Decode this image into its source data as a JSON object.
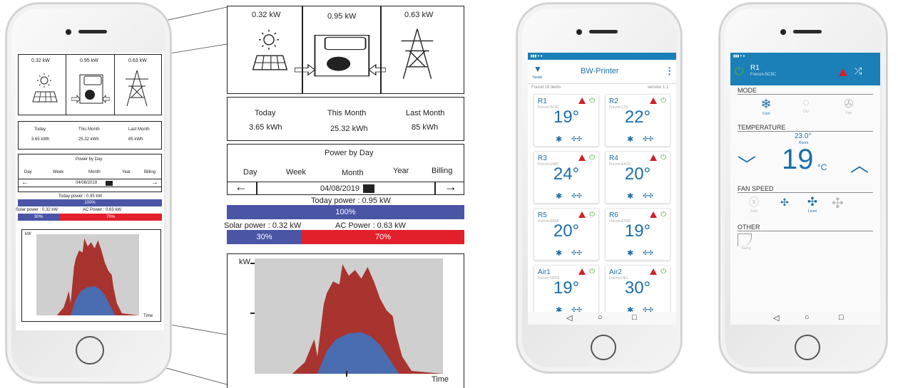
{
  "monitor": {
    "power_values": [
      "0.32 kW",
      "0.95 kW",
      "0.63 kW"
    ],
    "energy": {
      "headers": [
        "Today",
        "This Month",
        "Last Month"
      ],
      "values": [
        "3.65 kWh",
        "25.32 kWh",
        "85 kWh"
      ]
    },
    "power_by_day": {
      "title": "Power by Day",
      "tabs": [
        "Day",
        "Week",
        "Month",
        "Year",
        "Billing"
      ],
      "date": "04/08/2019",
      "prev_arrow": "←",
      "next_arrow": "→"
    },
    "today_power": {
      "label": "Today power : 0.95 kW",
      "percent_label": "100%",
      "percent": 100
    },
    "solar_power": {
      "label": "Solar power :  0.32 kW",
      "percent_label": "30%",
      "percent": 30
    },
    "ac_power": {
      "label": "AC Power : 0.63 kW",
      "percent_label": "70%",
      "percent": 70
    },
    "chart": {
      "y_label": "kW",
      "x_label": "Time"
    }
  },
  "ac_app": {
    "title": "BW-Printer",
    "menu_icon": "⋮",
    "wifi_label": "Tasaki",
    "found_text": "Found 16 items",
    "version_text": "version 1.1",
    "units": [
      {
        "name": "R1",
        "sub": "Frecon-5C9C",
        "temp": "19°"
      },
      {
        "name": "R2",
        "sub": "Frecon-C25",
        "temp": "22°"
      },
      {
        "name": "R3",
        "sub": "Frecon-E489",
        "temp": "24°"
      },
      {
        "name": "R4",
        "sub": "Frecon-E4CE",
        "temp": "20°"
      },
      {
        "name": "R5",
        "sub": "Frecon-E68A",
        "temp": "20°"
      },
      {
        "name": "R6",
        "sub": "Frecon-E7DC",
        "temp": "19°"
      },
      {
        "name": "Air1",
        "sub": "Frecon-DDFE",
        "temp": "19°"
      },
      {
        "name": "Air2",
        "sub": "Frecon-DE1",
        "temp": "30°"
      }
    ],
    "nav": [
      "◁",
      "○",
      "□"
    ]
  },
  "detail_app": {
    "unit_name": "R1",
    "unit_sub": "Frecon-5C9C",
    "mode_title": "MODE",
    "modes": [
      "Cool",
      "Dry",
      "Fan"
    ],
    "temperature_title": "TEMPERATURE",
    "room_temp": "23.0°",
    "room_label": "Room",
    "set_temp": "19",
    "unit": "°C",
    "down_arrow": "﹀",
    "up_arrow": "︿",
    "fan_title": "FAN SPEED",
    "fan_auto": "Auto",
    "fan_level": "Level",
    "other_title": "OTHER",
    "swing": "Swing",
    "nav": [
      "◁",
      "○",
      "□"
    ]
  },
  "colors": {
    "blue": "#4a55a6",
    "red": "#e2202b",
    "accent": "#1b6ea8",
    "power_green": "#4cae3a"
  }
}
